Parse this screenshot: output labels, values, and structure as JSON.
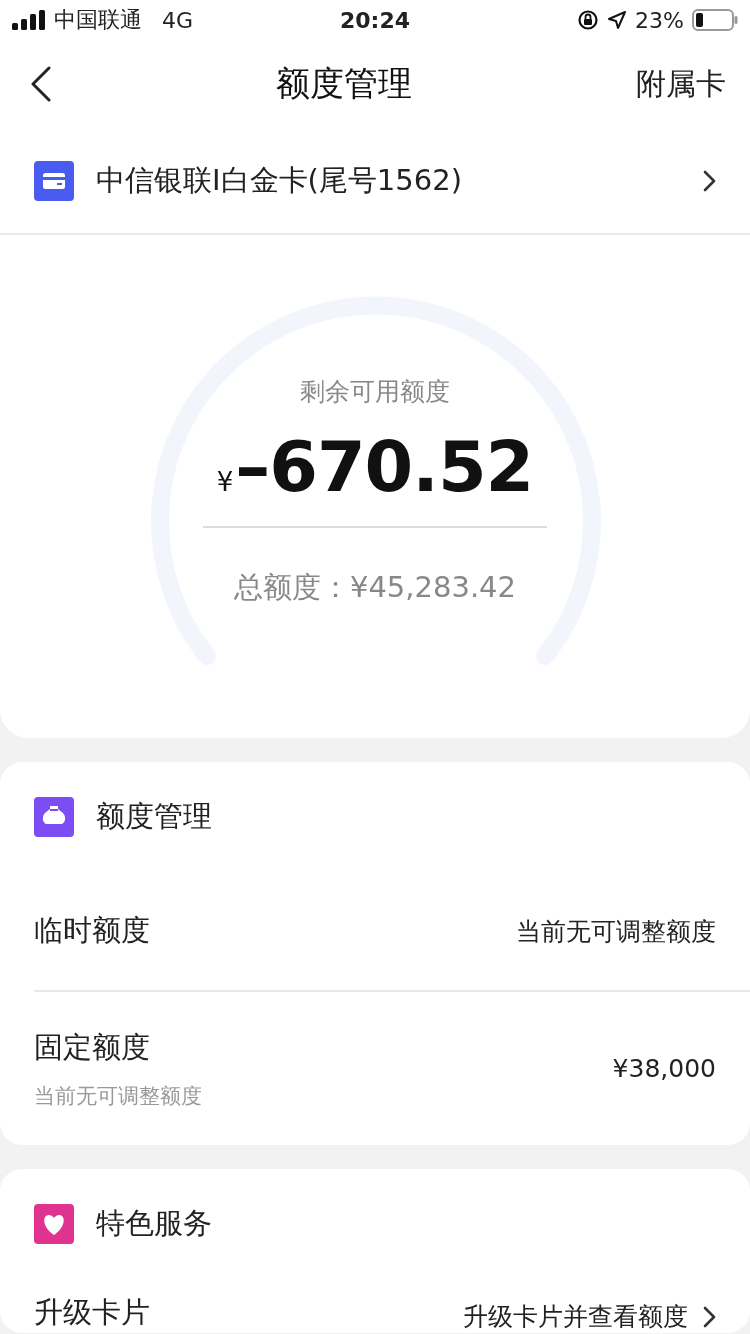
{
  "status_bar": {
    "carrier": "中国联通",
    "network": "4G",
    "time": "20:24",
    "battery": "23%"
  },
  "nav": {
    "title": "额度管理",
    "action": "附属卡"
  },
  "card_selector": {
    "label": "中信银联I白金卡(尾号1562)"
  },
  "summary": {
    "label": "剩余可用额度",
    "currency": "¥",
    "amount": "–670.52",
    "total": "总额度：¥45,283.42"
  },
  "sections": [
    {
      "title": "额度管理",
      "kind": "bag",
      "color": "#7b4df2",
      "rows": [
        {
          "label": "临时额度",
          "value": "当前无可调整额度",
          "arrow": false
        },
        {
          "label": "固定额度",
          "note": "当前无可调整额度",
          "value": "¥38,000",
          "arrow": false
        }
      ]
    },
    {
      "title": "特色服务",
      "kind": "heart",
      "color": "#e0338f",
      "rows": [
        {
          "label": "升级卡片",
          "value": "升级卡片并查看额度",
          "arrow": true
        }
      ]
    }
  ]
}
